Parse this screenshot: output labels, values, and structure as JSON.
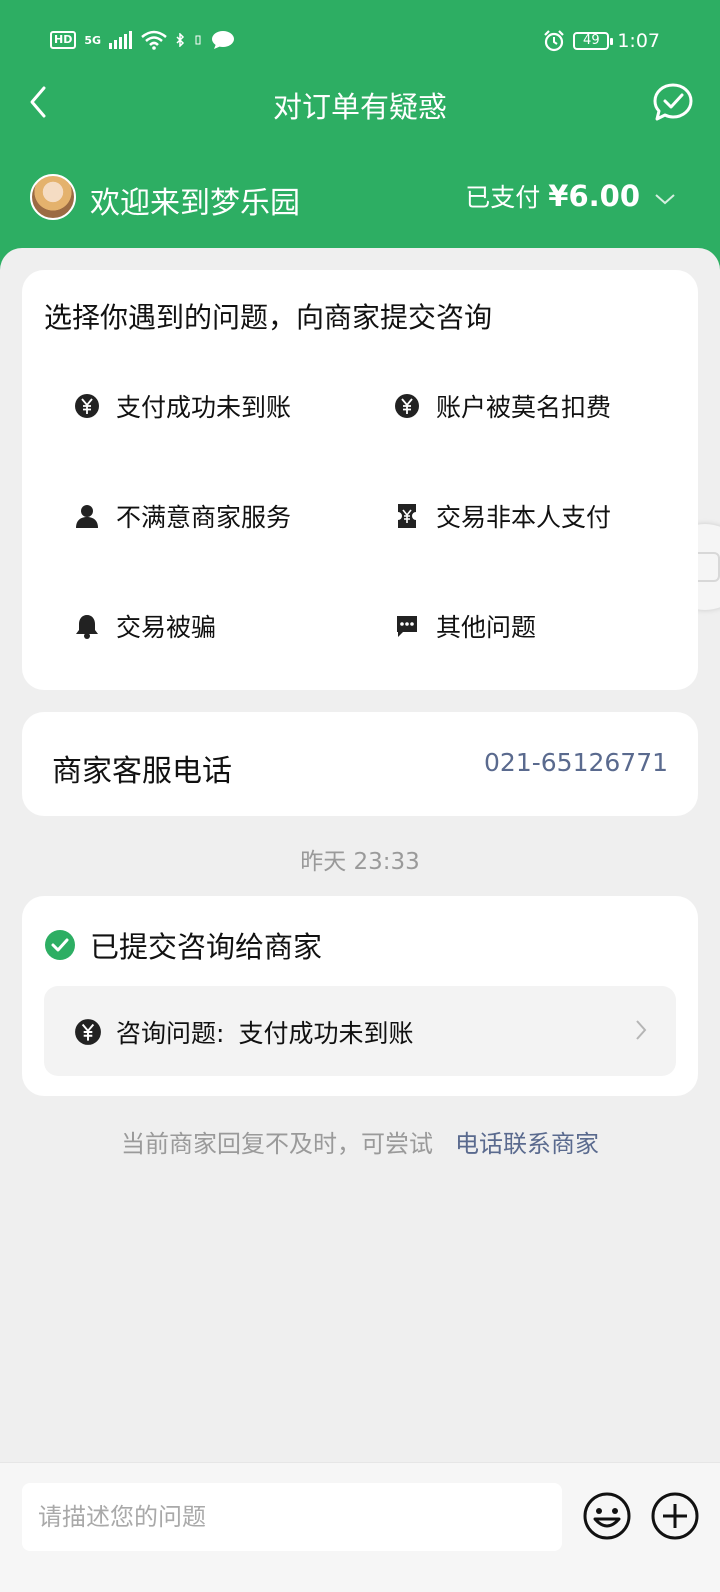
{
  "status_bar": {
    "hd": "HD",
    "signal": "5G",
    "battery": "49",
    "time": "1:07"
  },
  "header": {
    "title": "对订单有疑惑",
    "merchant_name": "欢迎来到梦乐园",
    "paid_label": "已支付",
    "paid_amount": "¥6.00",
    "accent_color": "#2dae63"
  },
  "issues": {
    "heading": "选择你遇到的问题，向商家提交咨询",
    "options": [
      {
        "label": "支付成功未到账",
        "icon": "yuan-icon"
      },
      {
        "label": "账户被莫名扣费",
        "icon": "yuan-icon"
      },
      {
        "label": "不满意商家服务",
        "icon": "person-icon"
      },
      {
        "label": "交易非本人支付",
        "icon": "ticket-icon"
      },
      {
        "label": "交易被骗",
        "icon": "bell-icon"
      },
      {
        "label": "其他问题",
        "icon": "message-icon"
      }
    ]
  },
  "service": {
    "label": "商家客服电话",
    "phone": "021-65126771"
  },
  "timestamp": "昨天 23:33",
  "submitted": {
    "status": "已提交咨询给商家",
    "inquiry_label": "咨询问题:",
    "inquiry_value": "支付成功未到账"
  },
  "hint": {
    "text": "当前商家回复不及时，可尝试",
    "link": "电话联系商家"
  },
  "composer": {
    "placeholder": "请描述您的问题"
  }
}
